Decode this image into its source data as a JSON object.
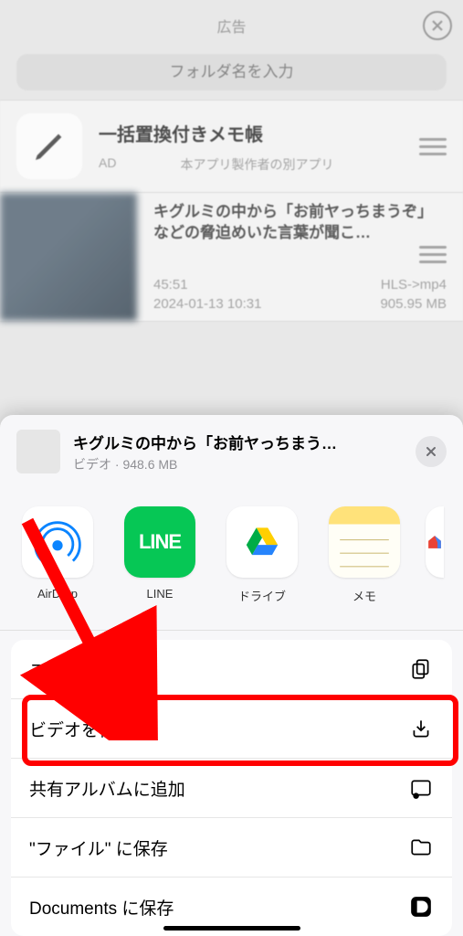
{
  "topbar": {
    "ad_label": "広告"
  },
  "search": {
    "placeholder": "フォルダ名を入力"
  },
  "promo_app": {
    "title": "一括置換付きメモ帳",
    "ad_text": "AD",
    "sub_text": "本アプリ製作者の別アプリ"
  },
  "video_item": {
    "title": "キグルミの中から「お前ヤっちまうぞ」などの脅迫めいた言葉が聞こ…",
    "duration": "45:51",
    "format": "HLS->mp4",
    "date": "2024-01-13 10:31",
    "size": "905.95 MB"
  },
  "sheet": {
    "title": "キグルミの中から「お前ヤっちまう…",
    "subtitle": "ビデオ · 948.6 MB",
    "apps": [
      "AirDrop",
      "LINE",
      "ドライブ",
      "メモ",
      ""
    ],
    "actions": {
      "copy": "コピー",
      "save_video": "ビデオを保存",
      "shared_album": "共有アルバムに追加",
      "save_files": "\"ファイル\" に保存",
      "save_documents": "Documents に保存"
    }
  }
}
